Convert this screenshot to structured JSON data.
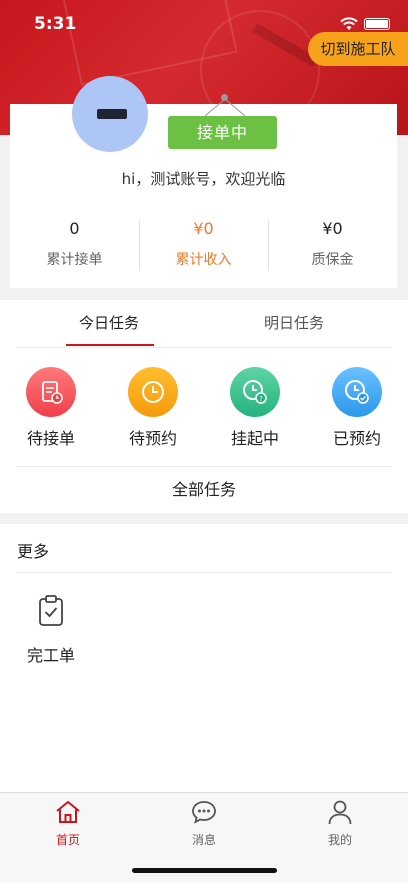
{
  "status_bar": {
    "time": "5:31"
  },
  "header": {
    "switch_button_label": "切到施工队"
  },
  "profile": {
    "status_label": "接单中",
    "greeting": "hi，测试账号，欢迎光临",
    "stats": [
      {
        "value": "0",
        "label": "累计接单"
      },
      {
        "value": "¥0",
        "label": "累计收入"
      },
      {
        "value": "¥0",
        "label": "质保金"
      }
    ]
  },
  "tasks": {
    "tabs": [
      {
        "label": "今日任务"
      },
      {
        "label": "明日任务"
      }
    ],
    "active_tab": "今日任务",
    "items": [
      {
        "label": "待接单",
        "icon": "clipboard-clock-icon"
      },
      {
        "label": "待预约",
        "icon": "clock-icon"
      },
      {
        "label": "挂起中",
        "icon": "clock-question-icon"
      },
      {
        "label": "已预约",
        "icon": "clock-check-icon"
      }
    ],
    "all_label": "全部任务"
  },
  "more": {
    "title": "更多",
    "items": [
      {
        "label": "完工单",
        "icon": "clipboard-check-icon"
      }
    ]
  },
  "tabbar": {
    "items": [
      {
        "label": "首页",
        "icon": "home-icon"
      },
      {
        "label": "消息",
        "icon": "chat-icon"
      },
      {
        "label": "我的",
        "icon": "user-icon"
      }
    ],
    "active": "首页"
  },
  "colors": {
    "brand_red": "#c8161d",
    "accent_orange": "#f7a21b",
    "status_green": "#6cc043",
    "income_orange": "#e97a2e"
  }
}
